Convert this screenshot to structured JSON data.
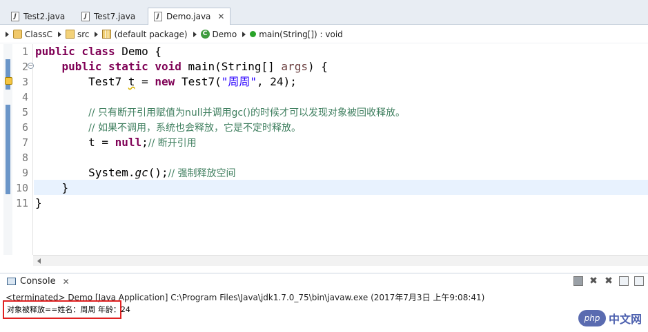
{
  "tabs": [
    {
      "label": "Test2.java",
      "icon": "java-file-icon",
      "active": false
    },
    {
      "label": "Test7.java",
      "icon": "java-file-icon",
      "active": false
    },
    {
      "label": "Demo.java",
      "icon": "java-file-icon",
      "active": true,
      "close": "✕"
    }
  ],
  "breadcrumb": {
    "project": "ClassC",
    "folder": "src",
    "package": "(default package)",
    "class": "Demo",
    "method": "main(String[]) : void"
  },
  "line_numbers": [
    "1",
    "2",
    "3",
    "4",
    "5",
    "6",
    "7",
    "8",
    "9",
    "10",
    "11"
  ],
  "code": {
    "l1_kw": "public class",
    "l1_rest": " Demo {",
    "l2_kw": "public static void",
    "l2_rest_a": " main(String[] ",
    "l2_param": "args",
    "l2_rest_b": ") {",
    "l3_a": "Test7 ",
    "l3_var": "t",
    "l3_b": " = ",
    "l3_kw": "new",
    "l3_c": " Test7(",
    "l3_str": "\"周周\"",
    "l3_d": ", 24);",
    "l5_comment": "// 只有断开引用赋值为null并调用gc()的时候才可以发现对象被回收释放。",
    "l6_comment": "// 如果不调用，系统也会释放，它是不定时释放。",
    "l7_a": "t = ",
    "l7_kw": "null",
    "l7_b": ";",
    "l7_comment": "// 断开引用",
    "l9_a": "System.",
    "l9_method": "gc",
    "l9_b": "();",
    "l9_comment": "// 强制释放空间",
    "l10": "}",
    "l11": "}"
  },
  "console": {
    "tab_label": "Console",
    "tab_close": "✕",
    "terminated": "<terminated> Demo [Java Application] C:\\Program Files\\Java\\jdk1.7.0_75\\bin\\javaw.exe (2017年7月3日 上午9:08:41)",
    "output": "对象被释放==姓名：周周 年龄：24"
  },
  "watermark": {
    "logo": "php",
    "text": "中文网"
  },
  "colors": {
    "keyword": "#7f0055",
    "string": "#2a00ff",
    "comment": "#3f7f5f",
    "highlight": "#e8f2fe",
    "output_box": "#e02020"
  }
}
